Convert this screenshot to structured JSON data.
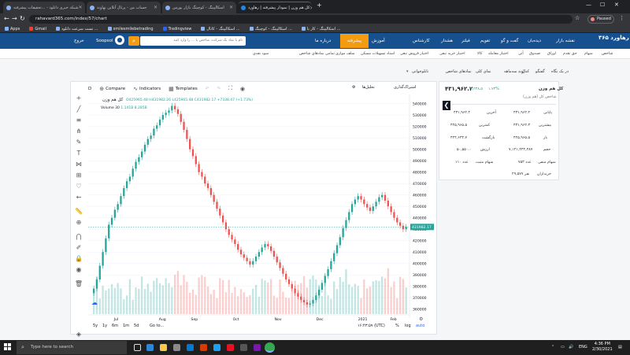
{
  "browser": {
    "tabs": [
      {
        "label": "شبکه خبری دانلود - ...تحقیقات پیشرفته",
        "active": false
      },
      {
        "label": "حساب من - پرتال آنلاین نهاوند",
        "active": false
      },
      {
        "label": "اسکالپینگ - کوچینگ بازار بورس",
        "active": false
      },
      {
        "label": "کل هم وزن | نمودار پیشرفته | رهاورد",
        "active": true
      }
    ],
    "new_tab": "+",
    "url": "rahavard365.com/index/57/chart",
    "paused_label": "Paused",
    "bookmarks": [
      "Apps",
      "Gmail",
      "تست سرعت دانلود ...",
      "smilesmilebetrading",
      "Tradingview",
      "اسکالپینگ - کانال ...",
      "اسکالپینگ - کوچینگ ...",
      "اسکالپینگ - کار با ..."
    ]
  },
  "site": {
    "logo": "رهاورد ۳۶۵",
    "nav": [
      "نقشه بازار",
      "دیده‌بان",
      "گفت و گو",
      "تقویم",
      "فیلتر",
      "هشدار",
      "کارشناس",
      "آموزش",
      "درباره ما"
    ],
    "premium_label": "پیشرفته",
    "search_placeholder": "نام یا نماد یک شرکت، شاخص یا ... را وارد کنید",
    "user_name": "Soopsol",
    "logout": "خروج",
    "subnav": [
      "شاخص",
      "سهام",
      "حق تقدم",
      "اوراق",
      "صندوق",
      "آتی",
      "اختیار معامله",
      "کالا",
      "اختیار خرید تبعی",
      "اختیار فروش تبعی",
      "اسناد تسهیلات مسکن",
      "سلف موازی",
      "تمامی نمادهای شاخص",
      "صندوق",
      "سود نقدی"
    ],
    "crumbs": [
      "نمادهای شاخص",
      "نمای کلی",
      "روند سه‌ماهه",
      "کدال",
      "گفتگو",
      "در یک نگاه"
    ],
    "crumb_share": "تابلوخوانی"
  },
  "chart_toolbar": {
    "interval": "D",
    "compare": "Compare",
    "indicators": "Indicators",
    "templates": "Templates",
    "analysis": "تحلیل‌ها",
    "save_label": "اشتراک‌گذاری"
  },
  "legend": {
    "title": "کل هم وزن",
    "ohlc": "O425965.48 H431982.26 L425965.48 C431982.17 +7338.47 (+1.73%)",
    "volume_label": "Volume 30",
    "volume_value": "1.141B 8.285B"
  },
  "chart_data": {
    "type": "candlestick",
    "title": "کل هم وزن",
    "x_ticks": [
      "Jul",
      "Aug",
      "Sep",
      "Oct",
      "Nov",
      "Dec",
      "2021",
      "Feb"
    ],
    "y_ticks": [
      360000,
      370000,
      380000,
      390000,
      400000,
      410000,
      420000,
      430000,
      440000,
      450000,
      460000,
      470000,
      480000,
      490000,
      500000,
      510000,
      520000,
      530000,
      540000
    ],
    "ylim": [
      355000,
      548000
    ],
    "current_price": 431982.17,
    "up_color": "#26a69a",
    "down_color": "#ef5350",
    "closes": [
      378000,
      386000,
      398000,
      410000,
      422000,
      434000,
      440000,
      447000,
      452000,
      459000,
      466000,
      472000,
      476000,
      483000,
      489000,
      493000,
      498000,
      504000,
      509000,
      512000,
      518000,
      521000,
      526000,
      530000,
      532000,
      534000,
      538000,
      535000,
      531000,
      524000,
      517000,
      509000,
      500000,
      494000,
      487000,
      480000,
      476000,
      470000,
      466000,
      460000,
      454000,
      448000,
      442000,
      436000,
      430000,
      425000,
      421000,
      417000,
      412000,
      408000,
      405000,
      402000,
      399000,
      402000,
      406000,
      410000,
      414000,
      417000,
      415000,
      411000,
      406000,
      401000,
      396000,
      391000,
      386000,
      382000,
      378000,
      374000,
      371000,
      368000,
      366000,
      364000,
      365000,
      368000,
      372000,
      377000,
      383000,
      389000,
      395000,
      402000,
      409000,
      416000,
      423000,
      431000,
      438000,
      445000,
      452000,
      456000,
      459000,
      456000,
      452000,
      449000,
      446000,
      450000,
      454000,
      458000,
      460000,
      455000,
      450000,
      445000,
      440000,
      436000,
      433000,
      430000,
      432000
    ],
    "volume_max": 8.285
  },
  "bottombar": {
    "ranges": [
      "5y",
      "1y",
      "6m",
      "1m",
      "5d"
    ],
    "goto": "Go to...",
    "time": "۱۶:۴۳:۵۹ (UTC)",
    "percent": "%",
    "log": "log",
    "auto": "auto"
  },
  "price_label": "431982.17",
  "info": {
    "name": "کل هم وزن",
    "value": "۴۳۱,۹۶۲.۲",
    "change": "۷,۲۳۸.۵",
    "pct": "۱.۷۳%",
    "sub": "شاخص کل (هم وزن)",
    "row0": [
      "پایانی",
      "۴۳۱,۹۶۲.۲",
      "آخرین",
      "۴۳۱,۹۶۲.۲"
    ],
    "rows": [
      [
        "بیشترین",
        "۴۳۱,۹۶۲.۳",
        "کمترین",
        "۴۲۵,۹۶۵.۵"
      ],
      [
        "باز",
        "۴۲۵,۹۶۵.۵",
        "بازگشت",
        "۴۲۴,۶۴۳.۷"
      ],
      [
        "حجم",
        "۷,۱۴۱,۲۳۲,۴۸۷",
        "ارزش",
        "۵۰,۵۵۰.۰"
      ],
      [
        "سهام منفی",
        "۷۵۳ عدد",
        "سهام مثبت",
        "۱۱۰ عدد"
      ],
      [
        "خریداران",
        "۲۹,۵۷۷ نفر",
        "",
        ""
      ]
    ]
  },
  "taskbar": {
    "search": "Type here to search",
    "time": "4:36 PM",
    "date": "2/30/2021",
    "lang": "ENG"
  }
}
